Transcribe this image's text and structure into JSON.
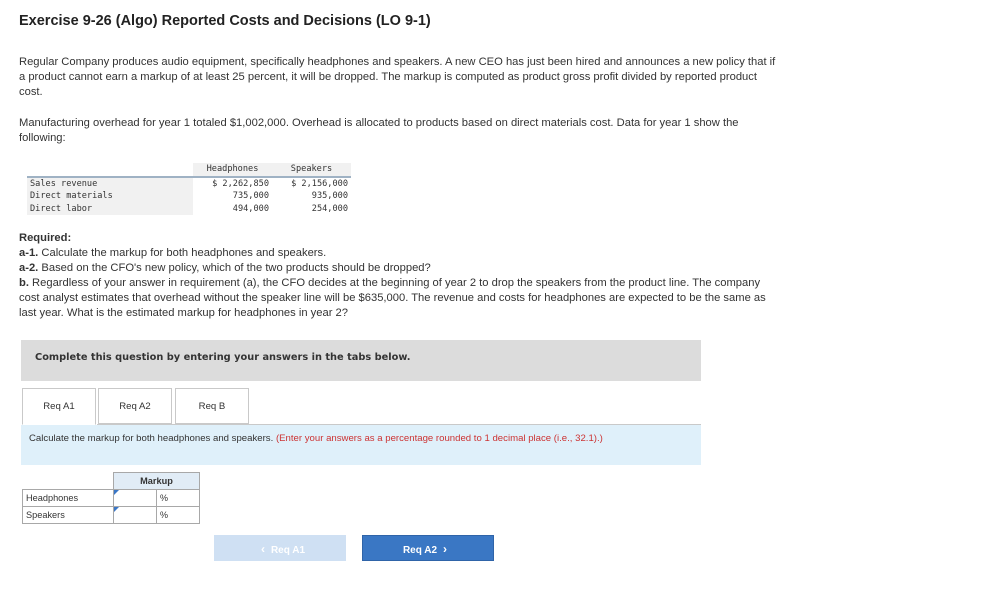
{
  "title": "Exercise 9-26 (Algo) Reported Costs and Decisions (LO 9-1)",
  "intro": "Regular Company produces audio equipment, specifically headphones and speakers. A new CEO has just been hired and announces a new policy that if a product cannot earn a markup of at least 25 percent, it will be dropped. The markup is computed as product gross profit divided by reported product cost.",
  "overhead_text": "Manufacturing overhead for year 1 totaled $1,002,000. Overhead is allocated to products based on direct materials cost. Data for year 1 show the following:",
  "data_table": {
    "columns": [
      "Headphones",
      "Speakers"
    ],
    "rows": [
      {
        "label": "Sales revenue",
        "headphones": "$ 2,262,850",
        "speakers": "$ 2,156,000"
      },
      {
        "label": "Direct materials",
        "headphones": "735,000",
        "speakers": "935,000"
      },
      {
        "label": "Direct labor",
        "headphones": "494,000",
        "speakers": "254,000"
      }
    ]
  },
  "required": {
    "heading": "Required:",
    "a1_label": "a-1.",
    "a1_text": " Calculate the markup for both headphones and speakers.",
    "a2_label": "a-2.",
    "a2_text": " Based on the CFO's new policy, which of the two products should be dropped?",
    "b_label": "b.",
    "b_text": " Regardless of your answer in requirement (a), the CFO decides at the beginning of year 2 to drop the speakers from the product line. The company cost analyst estimates that overhead without the speaker line will be $635,000. The revenue and costs for headphones are expected to be the same as last year. What is the estimated markup for headphones in year 2?"
  },
  "banner": "Complete this question by entering your answers in the tabs below.",
  "tabs": [
    {
      "label": "Req A1"
    },
    {
      "label": "Req A2"
    },
    {
      "label": "Req B"
    }
  ],
  "instruction": {
    "text": "Calculate the markup for both headphones and speakers.",
    "hint": "(Enter your answers as a percentage rounded to 1 decimal place (i.e., 32.1).)"
  },
  "answer_table": {
    "header": "Markup",
    "rows": [
      {
        "label": "Headphones",
        "value": "",
        "unit": "%"
      },
      {
        "label": "Speakers",
        "value": "",
        "unit": "%"
      }
    ]
  },
  "nav": {
    "prev_label": "Req A1",
    "next_label": "Req A2",
    "prev_icon": "chevron-left-icon",
    "next_icon": "chevron-right-icon"
  }
}
